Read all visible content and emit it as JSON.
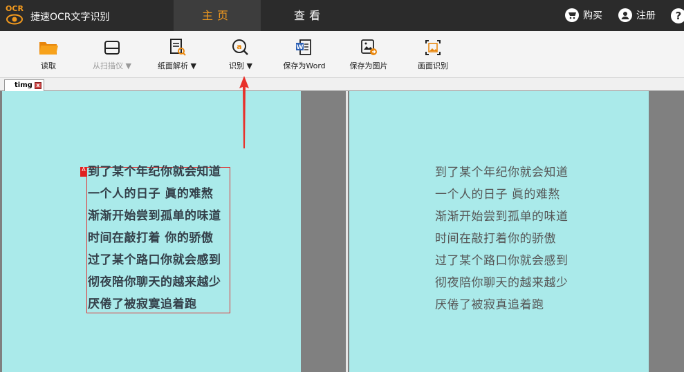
{
  "titlebar": {
    "logo_text": "OCR",
    "app_title": "捷速OCR文字识别",
    "tabs": [
      {
        "label": "主页",
        "active": true
      },
      {
        "label": "查看",
        "active": false
      }
    ],
    "buy_label": "购买",
    "register_label": "注册",
    "help_label": "?"
  },
  "toolbar": {
    "items": [
      {
        "label": "读取",
        "icon": "folder-icon",
        "enabled": true
      },
      {
        "label": "从扫描仪 ▼",
        "icon": "scanner-icon",
        "enabled": false
      },
      {
        "label": "纸面解析 ▼",
        "icon": "document-analyze-icon",
        "enabled": true
      },
      {
        "label": "识别 ▼",
        "icon": "recognize-icon",
        "enabled": true
      },
      {
        "label": "保存为Word",
        "icon": "word-icon",
        "enabled": true
      },
      {
        "label": "保存为图片",
        "icon": "save-image-icon",
        "enabled": true
      },
      {
        "label": "画面识别",
        "icon": "screen-capture-icon",
        "enabled": true
      }
    ]
  },
  "document_tab": {
    "name": "timg",
    "close": "x"
  },
  "source_page": {
    "marker": "A",
    "lines": [
      "到了某个年纪你就会知道",
      "一个人的日子 眞的难熬",
      "渐渐开始尝到孤单的味道",
      "时间在敲打着 你的骄傲",
      "过了某个路口你就会感到",
      "彻夜陪你聊天的越来越少",
      "厌倦了被寂寞追着跑"
    ]
  },
  "result_page": {
    "lines": [
      "到了某个年纪你就会知道",
      "一个人的日子  眞的难熬",
      "渐渐开始尝到孤单的味道",
      "时间在敲打着你的骄傲",
      "过了某个路口你就会感到",
      "彻夜陪你聊天的越来越少",
      "厌倦了被寂真追着跑"
    ]
  },
  "colors": {
    "titlebar_bg": "#2b2b2b",
    "accent": "#f39a1e",
    "page_bg": "#aaeaea",
    "panel_bg": "#808080",
    "selection": "#e03030"
  }
}
